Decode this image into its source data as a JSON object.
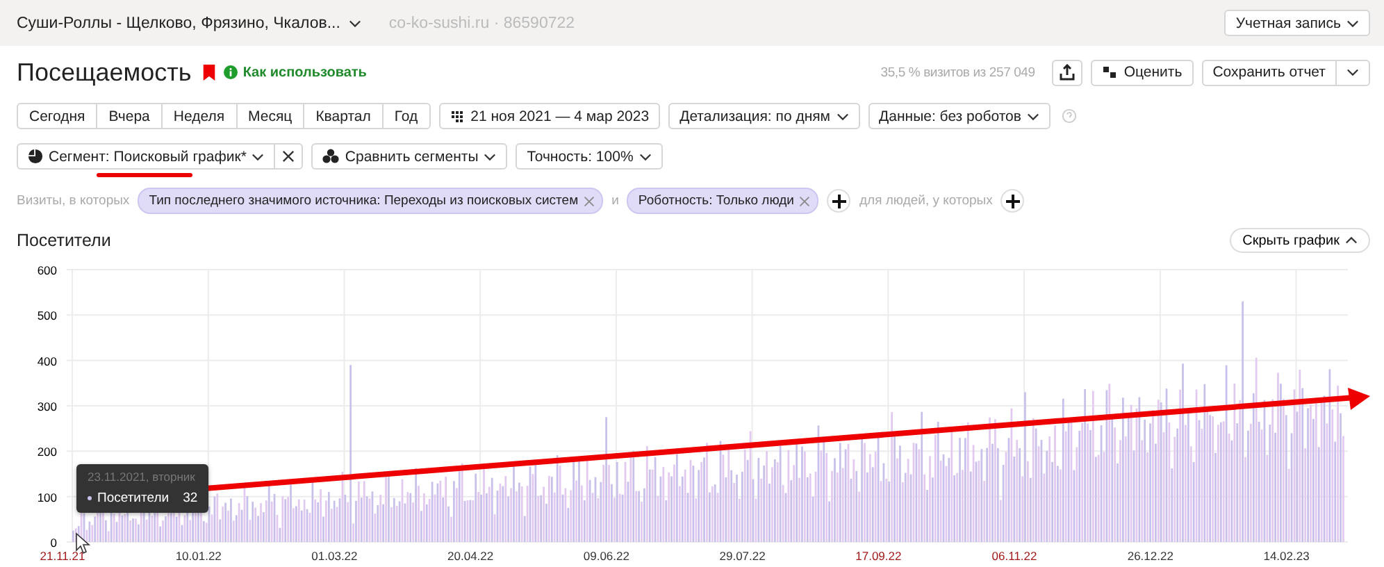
{
  "header": {
    "site_name": "Суши-Роллы - Щелково, Фрязино, Чкалов...",
    "site_meta": "co-ko-sushi.ru · 86590722",
    "account": "Учетная запись"
  },
  "report": {
    "title": "Посещаемость",
    "bookmarked": true,
    "help_link": "Как использовать",
    "sample_info": "35,5 % визитов из 257 049",
    "rate": "Оценить",
    "save": "Сохранить отчет"
  },
  "periods": [
    {
      "label": "Сегодня",
      "selected": false
    },
    {
      "label": "Вчера",
      "selected": false
    },
    {
      "label": "Неделя",
      "selected": false
    },
    {
      "label": "Месяц",
      "selected": false
    },
    {
      "label": "Квартал",
      "selected": false
    },
    {
      "label": "Год",
      "selected": false
    }
  ],
  "date_range": "21 ноя 2021 — 4 мар 2023",
  "detail": "Детализация: по дням",
  "data_filter": "Данные: без роботов",
  "segment": {
    "label": "Сегмент:",
    "value": "Поисковый график*"
  },
  "compare": "Сравнить сегменты",
  "accuracy": "Точность: 100%",
  "filters": {
    "prefix": "Визиты, в которых",
    "conditions": [
      "Тип последнего значимого источника: Переходы из поисковых систем",
      "Роботность: Только люди"
    ],
    "joiner": "и",
    "people_label": "для людей, у которых"
  },
  "chart": {
    "title": "Посетители",
    "hide": "Скрыть график",
    "y_labels": [
      "600",
      "500",
      "400",
      "300",
      "200",
      "100",
      "0"
    ],
    "x_labels": [
      {
        "label": "21.11.21",
        "holiday": true
      },
      {
        "label": "10.01.22",
        "holiday": false
      },
      {
        "label": "01.03.22",
        "holiday": false
      },
      {
        "label": "20.04.22",
        "holiday": false
      },
      {
        "label": "09.06.22",
        "holiday": false
      },
      {
        "label": "29.07.22",
        "holiday": false
      },
      {
        "label": "17.09.22",
        "holiday": true
      },
      {
        "label": "06.11.22",
        "holiday": true
      },
      {
        "label": "26.12.22",
        "holiday": false
      },
      {
        "label": "14.02.23",
        "holiday": false
      }
    ],
    "tooltip": {
      "date": "23.11.2021, вторник",
      "series": "Посетители",
      "value": "32"
    }
  }
}
